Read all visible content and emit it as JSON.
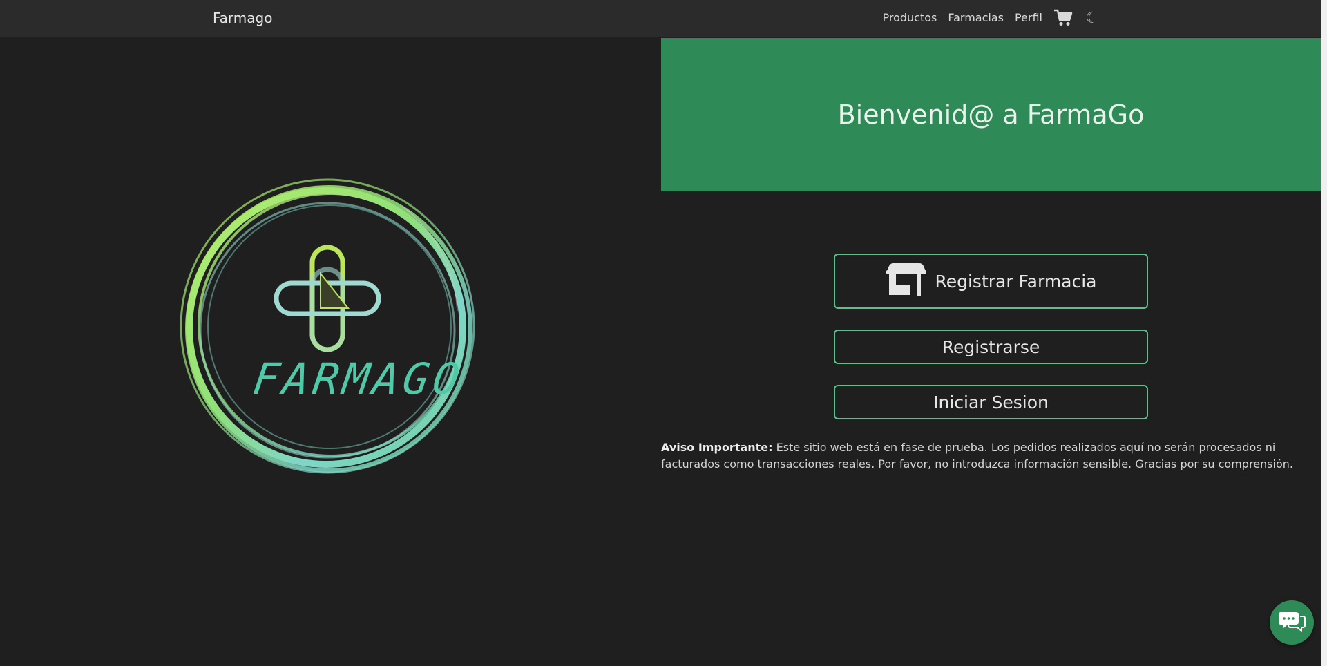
{
  "navbar": {
    "brand": "Farmago",
    "links": [
      "Productos",
      "Farmacias",
      "Perfil"
    ],
    "icons": [
      "cart-icon",
      "moon-icon"
    ],
    "moon_glyph": "☾"
  },
  "hero": {
    "title": "Bienvenid@ a FarmaGo",
    "background": "#2e8b57"
  },
  "logo": {
    "text": "FARMAGO"
  },
  "actions": {
    "register_pharmacy": "Registrar Farmacia",
    "register": "Registrarse",
    "login": "Iniciar Sesion"
  },
  "notice": {
    "label": "Aviso Importante:",
    "text": " Este sitio web está en fase de prueba. Los pedidos realizados aquí no serán procesados ni facturados como transacciones reales. Por favor, no introduzca información sensible. Gracias por su comprensión."
  },
  "colors": {
    "accent": "#2e8b57",
    "button_border": "#5fbf8a",
    "background": "#1f1f1f"
  }
}
